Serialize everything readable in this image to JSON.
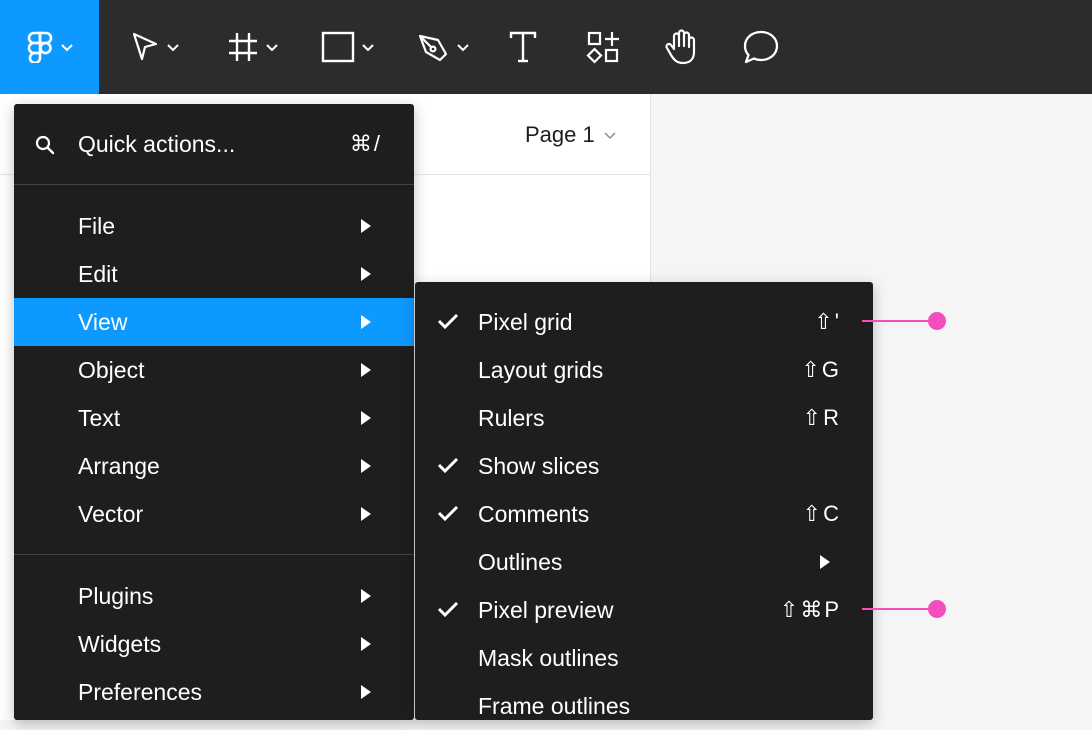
{
  "toolbar": {
    "tools": [
      {
        "name": "main-menu-button",
        "icon": "figma-logo-icon",
        "has_dropdown": true,
        "active": true
      },
      {
        "name": "move-tool",
        "icon": "cursor-arrow-icon",
        "has_dropdown": true
      },
      {
        "name": "frame-tool",
        "icon": "frame-hash-icon",
        "has_dropdown": true
      },
      {
        "name": "shape-tool",
        "icon": "rectangle-icon",
        "has_dropdown": true
      },
      {
        "name": "pen-tool",
        "icon": "pen-nib-icon",
        "has_dropdown": true
      },
      {
        "name": "text-tool",
        "icon": "text-t-icon",
        "has_dropdown": false
      },
      {
        "name": "resources-tool",
        "icon": "components-plus-icon",
        "has_dropdown": false
      },
      {
        "name": "hand-tool",
        "icon": "hand-icon",
        "has_dropdown": false
      },
      {
        "name": "comment-tool",
        "icon": "speech-bubble-icon",
        "has_dropdown": false
      }
    ]
  },
  "panel": {
    "page_name": "Page 1"
  },
  "main_menu": {
    "quick_actions": {
      "label": "Quick actions...",
      "shortcut": "⌘/"
    },
    "items": [
      {
        "label": "File",
        "has_submenu": true
      },
      {
        "label": "Edit",
        "has_submenu": true
      },
      {
        "label": "View",
        "has_submenu": true,
        "active": true
      },
      {
        "label": "Object",
        "has_submenu": true
      },
      {
        "label": "Text",
        "has_submenu": true
      },
      {
        "label": "Arrange",
        "has_submenu": true
      },
      {
        "label": "Vector",
        "has_submenu": true
      }
    ],
    "items2": [
      {
        "label": "Plugins",
        "has_submenu": true
      },
      {
        "label": "Widgets",
        "has_submenu": true
      },
      {
        "label": "Preferences",
        "has_submenu": true
      }
    ]
  },
  "view_submenu": {
    "items": [
      {
        "label": "Pixel grid",
        "checked": true,
        "shortcut": "⇧'"
      },
      {
        "label": "Layout grids",
        "checked": false,
        "shortcut": "⇧G"
      },
      {
        "label": "Rulers",
        "checked": false,
        "shortcut": "⇧R"
      },
      {
        "label": "Show slices",
        "checked": true,
        "shortcut": ""
      },
      {
        "label": "Comments",
        "checked": true,
        "shortcut": "⇧C"
      },
      {
        "label": "Outlines",
        "checked": false,
        "shortcut": "",
        "has_submenu": true
      },
      {
        "label": "Pixel preview",
        "checked": true,
        "shortcut": "⇧⌘P"
      },
      {
        "label": "Mask outlines",
        "checked": false,
        "shortcut": ""
      },
      {
        "label": "Frame outlines",
        "checked": false,
        "shortcut": ""
      }
    ]
  },
  "colors": {
    "toolbar_bg": "#2c2c2c",
    "accent": "#0d99ff",
    "menu_bg": "#1e1e1e",
    "annotation": "#f24ebc"
  }
}
